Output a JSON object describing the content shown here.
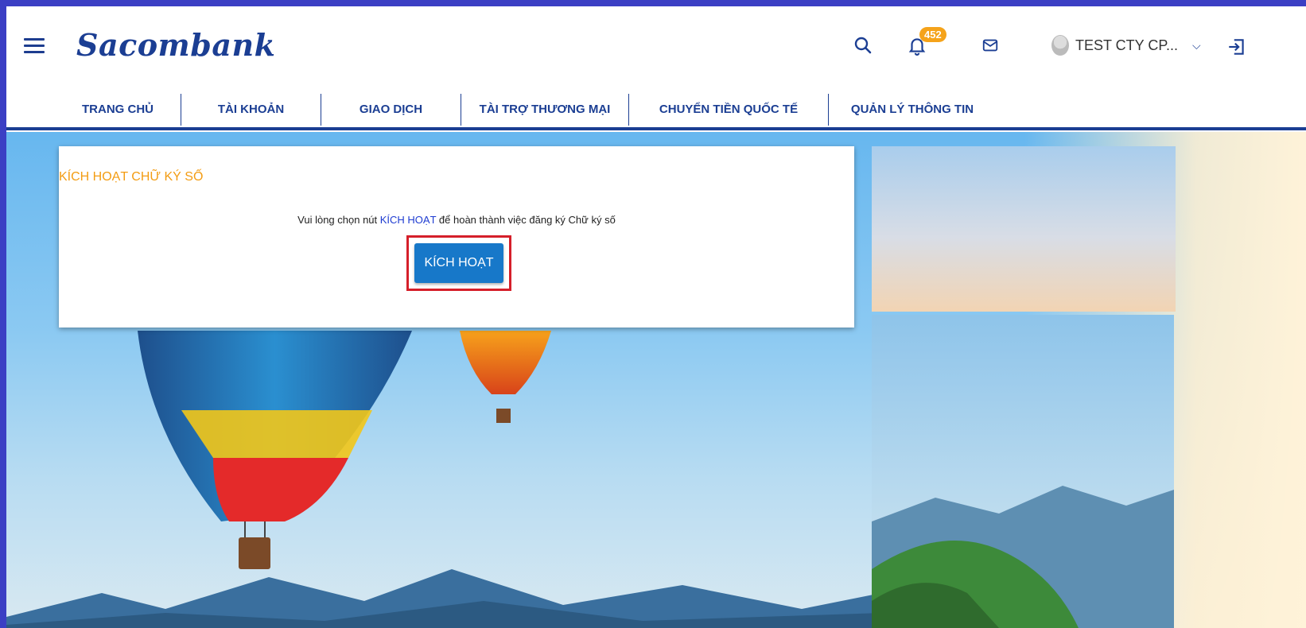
{
  "brand": {
    "logo": "Sacombank",
    "color": "#1b3e93",
    "accent": "#f5a31a"
  },
  "header": {
    "notifications_count": "452",
    "user_name": "TEST CTY CP...",
    "icons": [
      "menu-icon",
      "search-icon",
      "bell-icon",
      "mail-icon",
      "chevron-down-icon",
      "logout-icon"
    ]
  },
  "nav": {
    "items": [
      {
        "label": "TRANG CHỦ"
      },
      {
        "label": "TÀI KHOẢN"
      },
      {
        "label": "GIAO DỊCH"
      },
      {
        "label": "TÀI TRỢ THƯƠNG MẠI"
      },
      {
        "label": "CHUYỂN TIỀN QUỐC TẾ"
      },
      {
        "label": "QUẢN LÝ THÔNG TIN"
      }
    ]
  },
  "card": {
    "title": "KÍCH HOẠT CHỮ KÝ SỐ",
    "message_before": "Vui lòng chọn nút ",
    "message_highlight": "KÍCH HOẠT",
    "message_after": " để hoàn thành việc đăng ký Chữ ký số",
    "button_label": "KÍCH HOẠT",
    "title_color": "#f39c12",
    "button_color": "#1778c9",
    "highlight_box_color": "#d51f2a"
  }
}
